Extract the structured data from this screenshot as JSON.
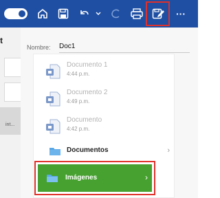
{
  "toolbar": {
    "icons": [
      "autosave-toggle",
      "home-icon",
      "save-icon",
      "undo-icon",
      "undo-dropdown-icon",
      "redo-icon",
      "print-icon",
      "edit-save-as-icon",
      "more-icon"
    ],
    "more_label": "···"
  },
  "left_pane": {
    "letter": "t",
    "tab_label": "int..."
  },
  "dialog": {
    "name_label": "Nombre:",
    "name_value": "Doc1",
    "documents": [
      {
        "name": "Documento 1",
        "time": "4:44 p.m."
      },
      {
        "name": "Documento 2",
        "time": "4:49 p.m."
      },
      {
        "name": "Documento",
        "time": "4:42 p.m."
      }
    ],
    "folders": [
      {
        "name": "Documentos"
      },
      {
        "name": "Imágenes",
        "selected": true
      }
    ]
  },
  "colors": {
    "toolbar": "#1f4fa3",
    "selected_folder": "#46a130",
    "highlight": "#e0302a",
    "folder_icon": "#5aa7e6",
    "doc_icon": "#7a98c9"
  }
}
